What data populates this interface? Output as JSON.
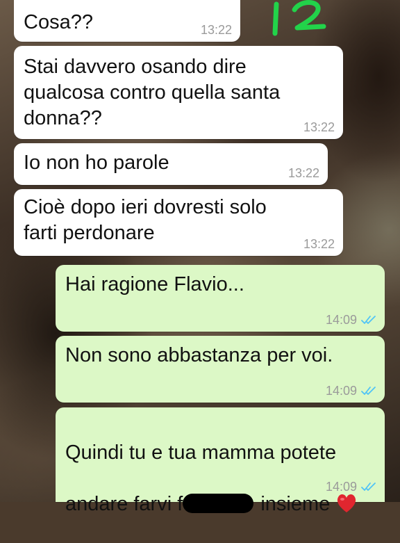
{
  "chat": {
    "annotation_text": "12",
    "colors": {
      "incoming_bubble": "#ffffff",
      "outgoing_bubble": "#dcf8c6",
      "read_ticks": "#4fc3f7",
      "marker": "#22d34a",
      "heart": "#e0262f"
    },
    "messages": [
      {
        "direction": "incoming",
        "text": "Cosa??",
        "time": "13:22"
      },
      {
        "direction": "incoming",
        "text": "Stai davvero osando dire\nqualcosa contro quella santa\ndonna??",
        "time": "13:22"
      },
      {
        "direction": "incoming",
        "text": "Io non ho parole",
        "time": "13:22"
      },
      {
        "direction": "incoming",
        "text": "Cioè dopo ieri dovresti solo\nfarti perdonare",
        "time": "13:22"
      },
      {
        "direction": "outgoing",
        "text": "Hai ragione Flavio...",
        "time": "14:09",
        "status": "read"
      },
      {
        "direction": "outgoing",
        "text": "Non sono abbastanza per voi.",
        "time": "14:09",
        "status": "read"
      },
      {
        "direction": "outgoing",
        "text_line1": "Quindi tu e tua mamma potete",
        "text_line2_before": "andare farvi f",
        "text_line2_after": " insieme",
        "redacted": true,
        "emoji": "heart-emoji",
        "time": "14:09",
        "status": "read"
      }
    ]
  }
}
